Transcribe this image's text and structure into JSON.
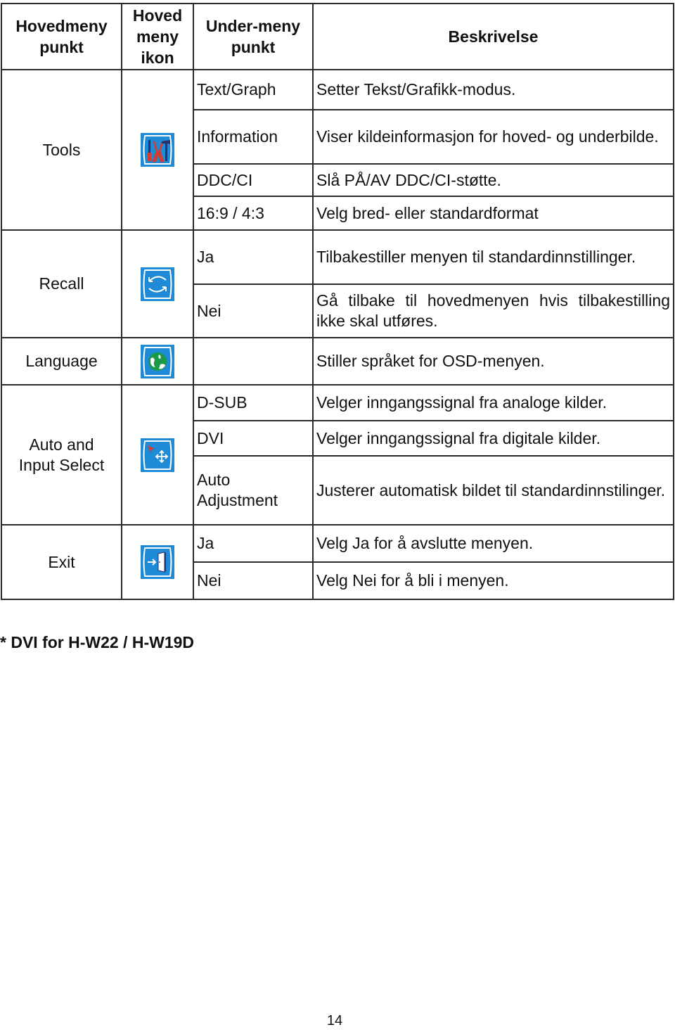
{
  "header": {
    "col_main": "Hovedmeny punkt",
    "col_icon": "Hoved meny ikon",
    "col_sub": "Under-meny punkt",
    "col_desc": "Beskrivelse"
  },
  "groups": [
    {
      "main": "Tools",
      "icon": "tools-icon",
      "rows": [
        {
          "sub": "Text/Graph",
          "desc": "Setter Tekst/Grafikk-modus."
        },
        {
          "sub": "Information",
          "desc": "Viser kildeinformasjon for hoved- og underbilde."
        },
        {
          "sub": "DDC/CI",
          "desc": "Slå PÅ/AV DDC/CI-støtte."
        },
        {
          "sub": "16:9 / 4:3",
          "desc": "Velg bred- eller standardformat"
        }
      ]
    },
    {
      "main": "Recall",
      "icon": "recall-icon",
      "rows": [
        {
          "sub": "Ja",
          "desc": "Tilbakestiller menyen til standardinnstillinger."
        },
        {
          "sub": "Nei",
          "desc": "Gå tilbake til hovedmenyen hvis tilbakestilling ikke skal utføres."
        }
      ]
    },
    {
      "main": "Language",
      "icon": "language-globe-icon",
      "rows": [
        {
          "sub": "",
          "desc": "Stiller språket for OSD-menyen."
        }
      ]
    },
    {
      "main": "Auto and Input Select",
      "icon": "auto-input-select-icon",
      "rows": [
        {
          "sub": "D-SUB",
          "desc": "Velger inngangssignal fra analoge kilder."
        },
        {
          "sub": "DVI",
          "desc": "Velger inngangssignal fra digitale kilder."
        },
        {
          "sub": "Auto Adjustment",
          "desc": "Justerer automatisk bildet til standardinnstilinger."
        }
      ]
    },
    {
      "main": "Exit",
      "icon": "exit-door-icon",
      "rows": [
        {
          "sub": "Ja",
          "desc": "Velg Ja for å avslutte menyen."
        },
        {
          "sub": "Nei",
          "desc": "Velg Nei for å bli i menyen."
        }
      ]
    }
  ],
  "footnote": "* DVI for H-W22 / H-W19D",
  "page_number": "14",
  "colors": {
    "icon_bg": "#1f8ad6",
    "border": "#2a2a2a"
  }
}
